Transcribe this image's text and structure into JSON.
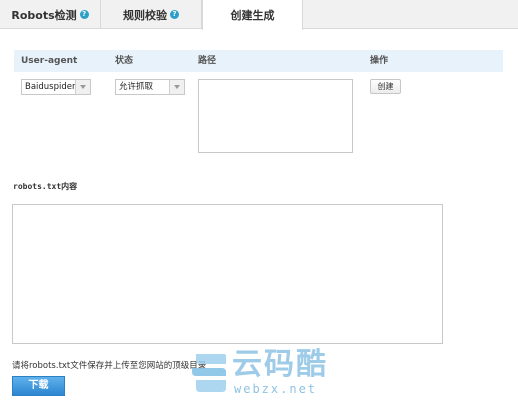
{
  "tabs": [
    {
      "label": "Robots检测",
      "help": "?"
    },
    {
      "label": "规则校验",
      "help": "?"
    },
    {
      "label": "创建生成"
    }
  ],
  "table": {
    "headers": [
      "User-agent",
      "状态",
      "路径",
      "操作"
    ],
    "user_agent_value": "Baiduspider",
    "status_value": "允许抓取",
    "path_value": "",
    "create_label": "创建"
  },
  "robots": {
    "label": "robots.txt内容",
    "content": ""
  },
  "note": "请将robots.txt文件保存并上传至您网站的顶级目录",
  "download_label": "下载",
  "watermark": {
    "title": "云码酷",
    "subtitle": "webzx.net"
  }
}
